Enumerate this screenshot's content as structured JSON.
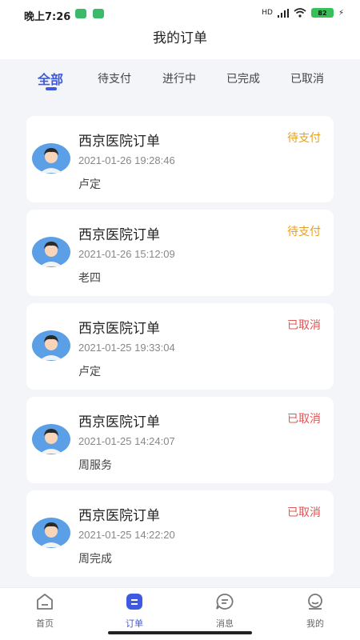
{
  "status_bar": {
    "time": "晚上7:26",
    "battery": "82",
    "network": "HD"
  },
  "header": {
    "title": "我的订单"
  },
  "tabs": [
    {
      "label": "全部",
      "active": true
    },
    {
      "label": "待支付",
      "active": false
    },
    {
      "label": "进行中",
      "active": false
    },
    {
      "label": "已完成",
      "active": false
    },
    {
      "label": "已取消",
      "active": false
    }
  ],
  "orders": [
    {
      "hospital": "西京医院订单",
      "time": "2021-01-26 19:28:46",
      "name": "卢定",
      "status": "待支付",
      "status_color": "#e8a01c"
    },
    {
      "hospital": "西京医院订单",
      "time": "2021-01-26 15:12:09",
      "name": "老四",
      "status": "待支付",
      "status_color": "#e8a01c"
    },
    {
      "hospital": "西京医院订单",
      "time": "2021-01-25 19:33:04",
      "name": "卢定",
      "status": "已取消",
      "status_color": "#e05555"
    },
    {
      "hospital": "西京医院订单",
      "time": "2021-01-25 14:24:07",
      "name": "周服务",
      "status": "已取消",
      "status_color": "#e05555"
    },
    {
      "hospital": "西京医院订单",
      "time": "2021-01-25 14:22:20",
      "name": "周完成",
      "status": "已取消",
      "status_color": "#e05555"
    }
  ],
  "bottom_nav": [
    {
      "label": "首页",
      "icon": "home-icon",
      "active": false
    },
    {
      "label": "订单",
      "icon": "order-icon",
      "active": true
    },
    {
      "label": "消息",
      "icon": "message-icon",
      "active": false
    },
    {
      "label": "我的",
      "icon": "profile-icon",
      "active": false
    }
  ],
  "colors": {
    "accent": "#3d5ae0",
    "pending": "#e8a01c",
    "cancelled": "#e05555"
  }
}
